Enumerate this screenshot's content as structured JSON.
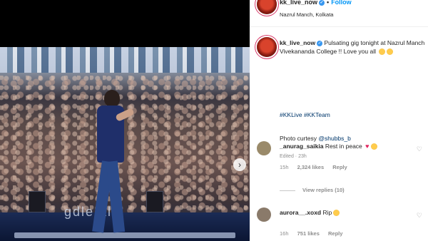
{
  "post": {
    "username": "kk_live_now",
    "follow_label": "Follow",
    "separator": "•",
    "location": "Nazrul Manch, Kolkata",
    "caption_username": "kk_live_now",
    "caption_text": "Pulsating gig tonight at Nazrul Manch Vivekananda College !! Love you all",
    "hashtags": "#KKLive #KKTeam",
    "credit_prefix": "Photo curtesy",
    "credit_mention": "@shubbs_b",
    "edited": "Edited · 23h",
    "stage_text": "gdle  al",
    "next_icon": "›"
  },
  "comments": [
    {
      "username": "_anurag_saikia",
      "text": "Rest in peace",
      "time": "15h",
      "likes": "2,324 likes",
      "reply_label": "Reply",
      "avatar_color": "#9a8a6a"
    },
    {
      "username": "aurora__.xoxd",
      "text": "Rip",
      "time": "16h",
      "likes": "751 likes",
      "reply_label": "Reply",
      "avatar_color": "#8a7a6a"
    }
  ],
  "view_replies_label": "View replies (10)",
  "colors": {
    "accent": "#0095f6",
    "verified": "#3897f0",
    "hashtag": "#00376b"
  }
}
